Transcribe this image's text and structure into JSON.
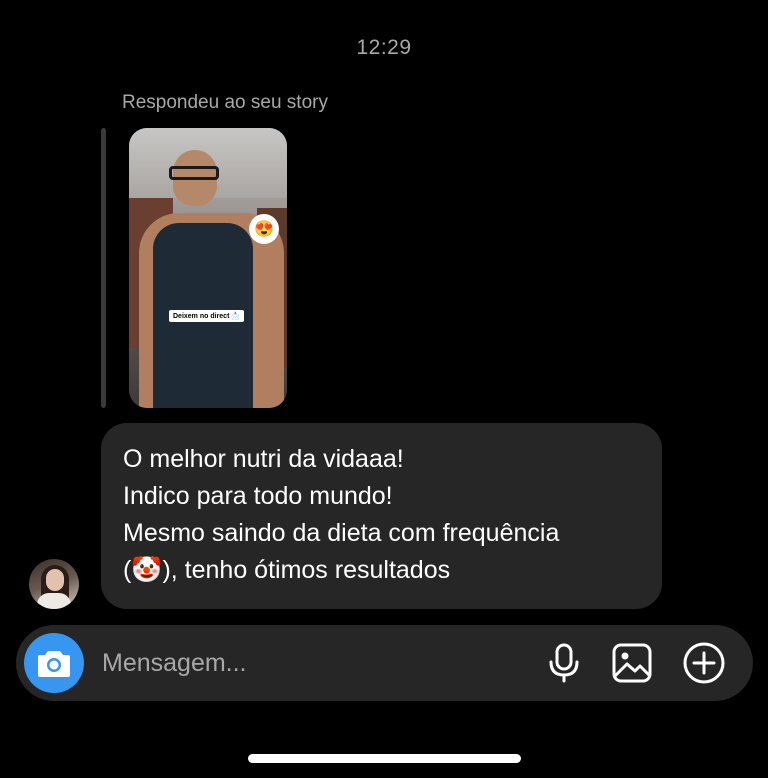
{
  "header": {
    "time": "12:29"
  },
  "story_reply": {
    "label": "Respondeu ao seu story",
    "caption": "Deixem no direct 📩",
    "sticker_emoji": "😍"
  },
  "message": {
    "lines": [
      "O melhor nutri da vidaaa!",
      "Indico para todo mundo!",
      "Mesmo saindo da dieta com frequência",
      "(🤡), tenho ótimos resultados"
    ]
  },
  "composer": {
    "placeholder": "Mensagem...",
    "icons": {
      "camera": "camera-icon",
      "mic": "microphone-icon",
      "gallery": "image-gallery-icon",
      "plus": "plus-circle-icon"
    }
  },
  "colors": {
    "background": "#000000",
    "bubble": "#262626",
    "accent": "#3797f0",
    "secondary_text": "#a8a8a8"
  }
}
